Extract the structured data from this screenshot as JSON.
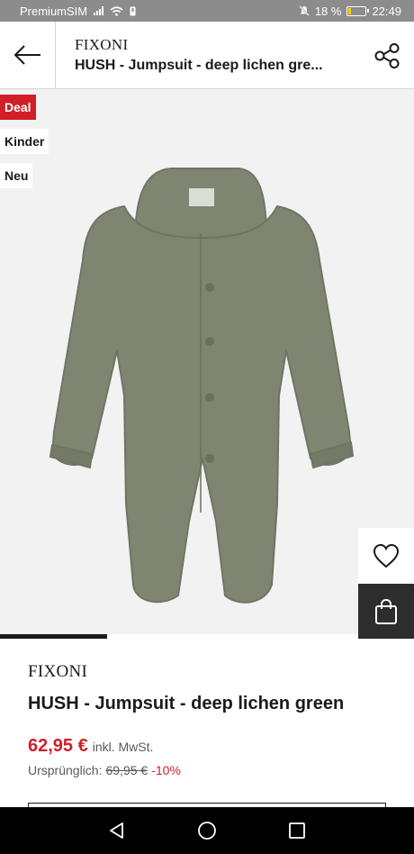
{
  "status_bar": {
    "carrier": "PremiumSIM",
    "battery_percent": "18 %",
    "battery_level": 0.18,
    "time": "22:49"
  },
  "header": {
    "brand": "FIXONI",
    "title": "HUSH - Jumpsuit - deep lichen gre..."
  },
  "badges": {
    "deal": "Deal",
    "kinder": "Kinder",
    "neu": "Neu"
  },
  "gallery": {
    "progress": 0.3
  },
  "product": {
    "brand": "FIXONI",
    "title": "HUSH - Jumpsuit - deep lichen green",
    "price": "62,95 €",
    "tax_note": "inkl. MwSt.",
    "original_label": "Ursprünglich:",
    "original_price": "69,95 €",
    "discount": "-10%"
  },
  "colors": {
    "accent_red": "#d01f27",
    "garment": "#7f8571",
    "dark": "#2d2d2d"
  },
  "icons": {
    "back": "arrow-left-icon",
    "share": "share-icon",
    "wishlist": "heart-icon",
    "bag": "shopping-bag-icon",
    "nav_back": "triangle-back-icon",
    "nav_home": "circle-home-icon",
    "nav_recent": "square-recent-icon"
  }
}
